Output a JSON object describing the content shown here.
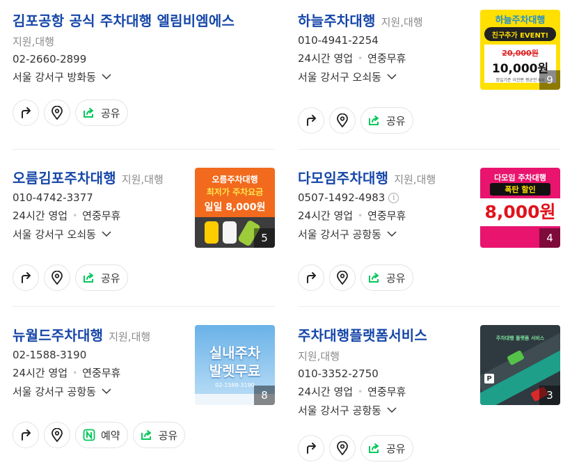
{
  "listings": [
    {
      "name": "김포공항 공식 주차대행 엘림비엠에스",
      "category": "지원,대행",
      "phone": "02-2660-2899",
      "address": "서울 강서구 방화동",
      "actions": [
        "공유"
      ]
    },
    {
      "name": "하늘주차대행",
      "category": "지원,대행",
      "phone": "010-4941-2254",
      "hours": "24시간 영업",
      "holiday": "연중무휴",
      "address": "서울 강서구 오쇠동",
      "actions": [
        "공유"
      ],
      "thumb": {
        "title": "하늘주차대행",
        "badge": "친구추가 EVENT!",
        "old_price": "20,000원",
        "price": "10,000원",
        "note": "정일기준 이전편 평균전 8시",
        "count": "9"
      }
    },
    {
      "name": "오름김포주차대행",
      "category": "지원,대행",
      "phone": "010-4742-3377",
      "hours": "24시간 영업",
      "holiday": "연중무휴",
      "address": "서울 강서구 오쇠동",
      "actions": [
        "공유"
      ],
      "thumb": {
        "title": "오름주차대행",
        "line1": "최저가 주차요금",
        "price": "일일 8,000원",
        "count": "5"
      }
    },
    {
      "name": "다모임주차대행",
      "category": "지원,대행",
      "phone": "0507-1492-4983",
      "info_icon": "i",
      "hours": "24시간 영업",
      "holiday": "연중무휴",
      "address": "서울 강서구 공항동",
      "actions": [
        "공유"
      ],
      "thumb": {
        "title": "다모임 주차대행",
        "badge": "폭탄 할인",
        "price": "8,000원",
        "count": "4"
      }
    },
    {
      "name": "뉴월드주차대행",
      "category": "지원,대행",
      "phone": "02-1588-3190",
      "hours": "24시간 영업",
      "holiday": "연중무휴",
      "address": "서울 강서구 공항동",
      "actions": [
        "예약",
        "공유"
      ],
      "thumb": {
        "line1": "실내주차",
        "line2": "발렛무료",
        "phone": "02-1588-3190",
        "count": "8"
      }
    },
    {
      "name": "주차대행플랫폼서비스",
      "category": "지원,대행",
      "phone": "010-3352-2750",
      "hours": "24시간 영업",
      "holiday": "연중무휴",
      "address": "서울 강서구 공항동",
      "actions": [
        "공유"
      ],
      "thumb": {
        "line1": "주차대행 플랫폼 서비스",
        "count": "3"
      }
    }
  ],
  "colors": {
    "title": "#1546a8",
    "share_green": "#03c75a"
  }
}
